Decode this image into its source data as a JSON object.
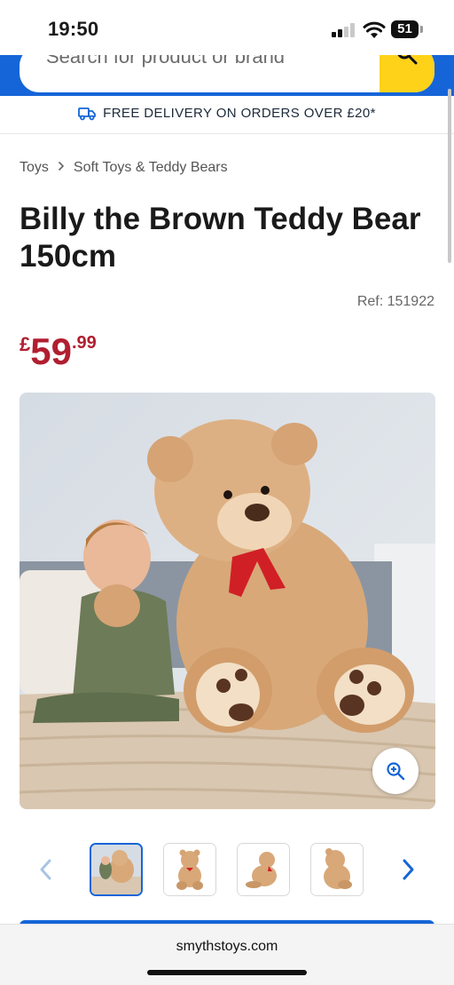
{
  "status_bar": {
    "time": "19:50",
    "battery": "51"
  },
  "search": {
    "placeholder": "Search for product or brand"
  },
  "delivery_banner": {
    "text": "FREE DELIVERY ON ORDERS OVER £20*"
  },
  "breadcrumb": {
    "items": [
      "Toys",
      "Soft Toys & Teddy Bears"
    ]
  },
  "product": {
    "title": "Billy the Brown Teddy Bear 150cm",
    "ref": "Ref: 151922",
    "price": {
      "currency": "£",
      "main": "59",
      "pence": ".99"
    }
  },
  "gallery": {
    "thumbnails": [
      "thumbnail-1",
      "thumbnail-2",
      "thumbnail-3",
      "thumbnail-4"
    ],
    "active_index": 0
  },
  "browser": {
    "domain": "smythstoys.com"
  },
  "colors": {
    "brand_blue": "#1565d8",
    "search_yellow": "#ffd21a",
    "price_red": "#b11e30"
  },
  "icons": [
    "signal-icon",
    "wifi-icon",
    "battery-icon",
    "search-icon",
    "truck-icon",
    "chevron-right-icon",
    "zoom-icon",
    "chevron-left-icon"
  ]
}
